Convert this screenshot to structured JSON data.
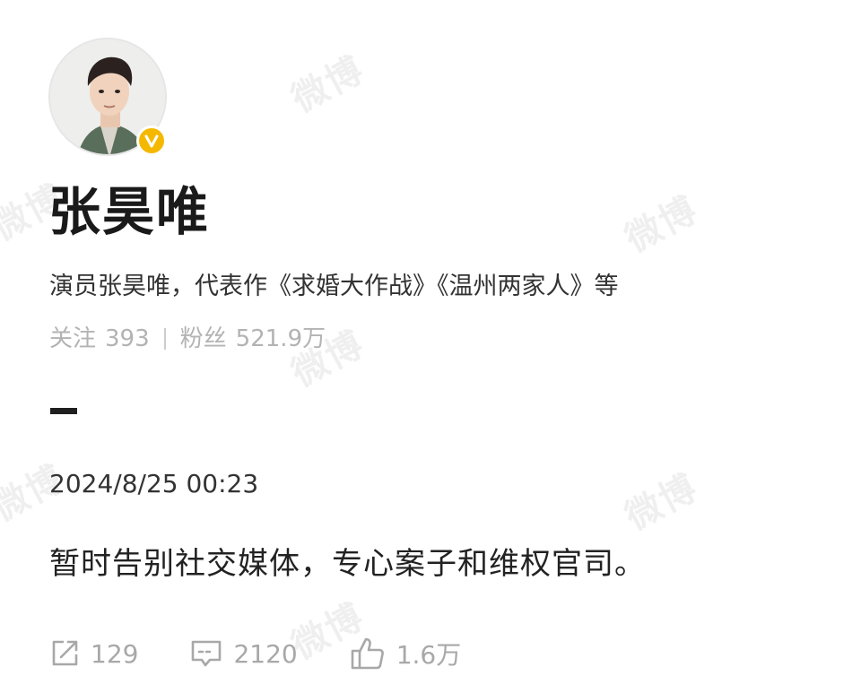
{
  "watermark_text": "微博",
  "profile": {
    "avatar_icon": "user-avatar-photo",
    "verified_icon": "verified-v-badge",
    "verified_color": "#f5b800",
    "name": "张昊唯",
    "bio": "演员张昊唯，代表作《求婚大作战》《温州两家人》等",
    "following_label": "关注",
    "following_count": "393",
    "followers_label": "粉丝",
    "followers_count": "521.9万"
  },
  "post": {
    "timestamp": "2024/8/25 00:23",
    "text": "暂时告别社交媒体，专心案子和维权官司。",
    "repost_icon": "repost-icon",
    "repost_count": "129",
    "comment_icon": "comment-icon",
    "comment_count": "2120",
    "like_icon": "thumbs-up-icon",
    "like_count": "1.6万"
  }
}
